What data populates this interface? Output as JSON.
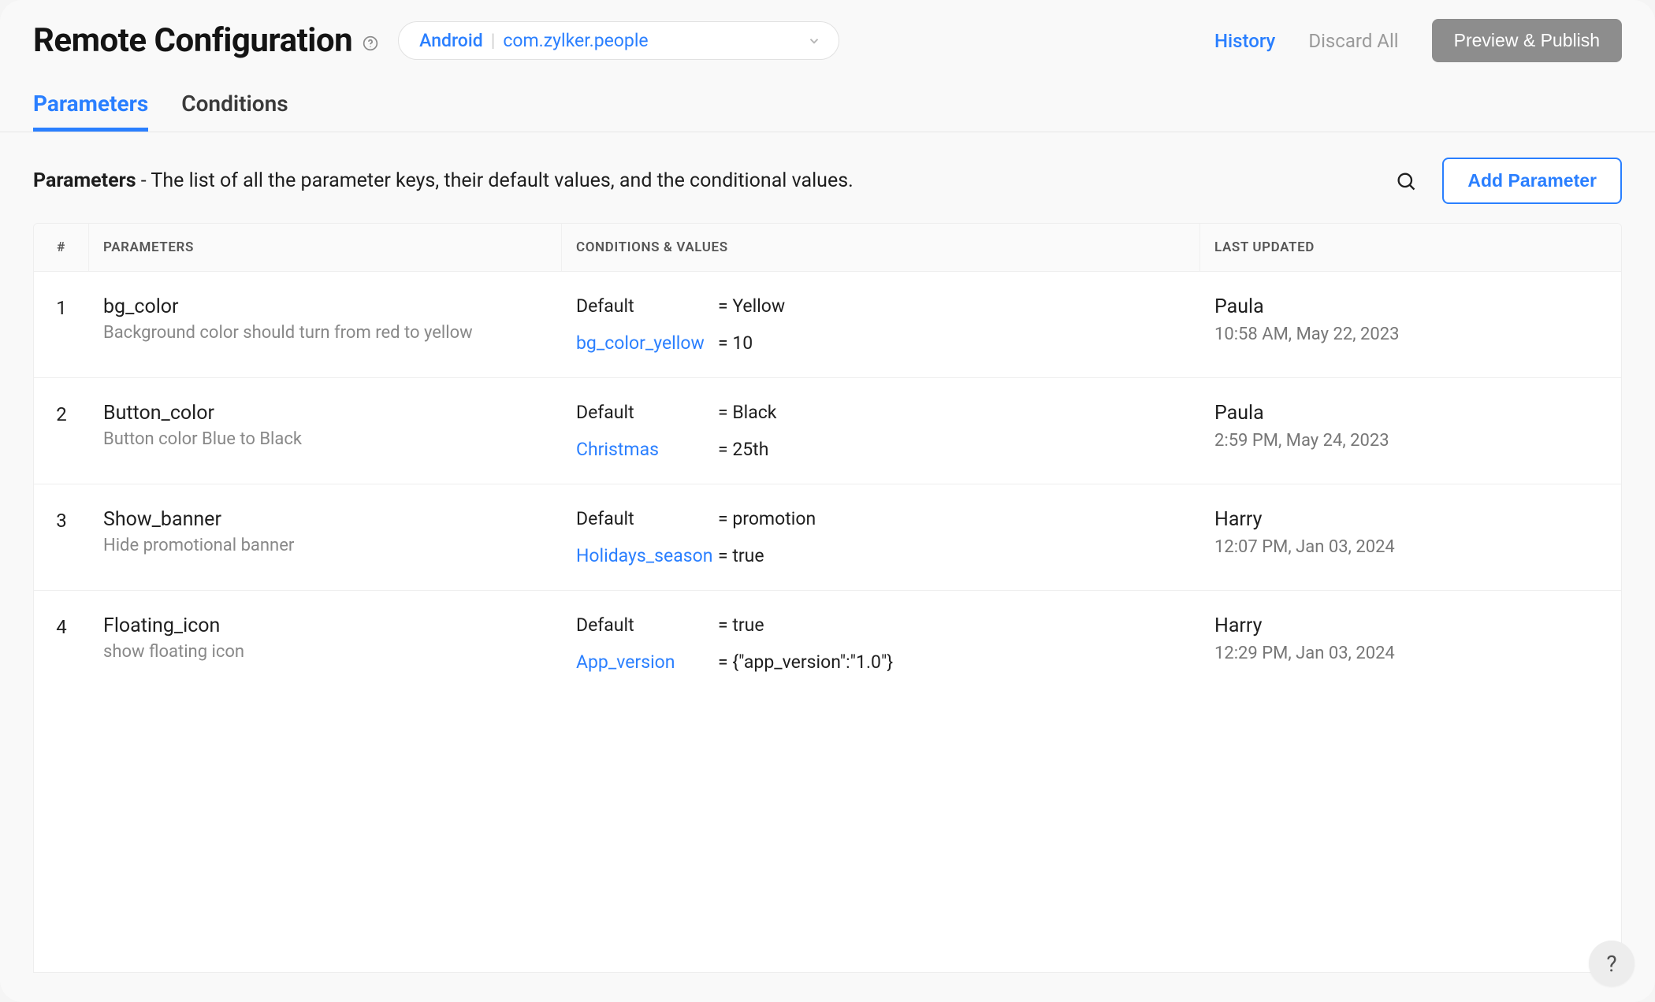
{
  "header": {
    "title": "Remote Configuration",
    "app_selector": {
      "platform": "Android",
      "package": "com.zylker.people"
    },
    "history_label": "History",
    "discard_label": "Discard All",
    "publish_label": "Preview & Publish"
  },
  "tabs": [
    {
      "label": "Parameters",
      "active": true
    },
    {
      "label": "Conditions",
      "active": false
    }
  ],
  "subheader": {
    "title": "Parameters",
    "desc": " - The list of all the parameter keys, their default values, and the conditional values.",
    "add_label": "Add Parameter"
  },
  "columns": {
    "idx": "#",
    "parameters": "Parameters",
    "conditions": "Conditions & Values",
    "updated": "Last Updated"
  },
  "rows": [
    {
      "idx": "1",
      "name": "bg_color",
      "desc": "Background color should turn from red to yellow",
      "conds": [
        {
          "key": "Default",
          "link": false,
          "val": "= Yellow"
        },
        {
          "key": "bg_color_yellow",
          "link": true,
          "val": "= 10"
        }
      ],
      "updated_by": "Paula",
      "updated_at": "10:58 AM, May 22, 2023"
    },
    {
      "idx": "2",
      "name": "Button_color",
      "desc": "Button color Blue to Black",
      "conds": [
        {
          "key": "Default",
          "link": false,
          "val": "= Black"
        },
        {
          "key": "Christmas",
          "link": true,
          "val": "= 25th"
        }
      ],
      "updated_by": "Paula",
      "updated_at": "2:59 PM, May 24, 2023"
    },
    {
      "idx": "3",
      "name": "Show_banner",
      "desc": "Hide promotional banner",
      "conds": [
        {
          "key": "Default",
          "link": false,
          "val": "= promotion"
        },
        {
          "key": "Holidays_season",
          "link": true,
          "val": "= true"
        }
      ],
      "updated_by": "Harry",
      "updated_at": "12:07 PM, Jan 03, 2024"
    },
    {
      "idx": "4",
      "name": "Floating_icon",
      "desc": "show floating icon",
      "conds": [
        {
          "key": "Default",
          "link": false,
          "val": "= true"
        },
        {
          "key": "App_version",
          "link": true,
          "val": "= {\"app_version\":\"1.0\"}"
        }
      ],
      "updated_by": "Harry",
      "updated_at": "12:29 PM, Jan 03, 2024"
    }
  ]
}
